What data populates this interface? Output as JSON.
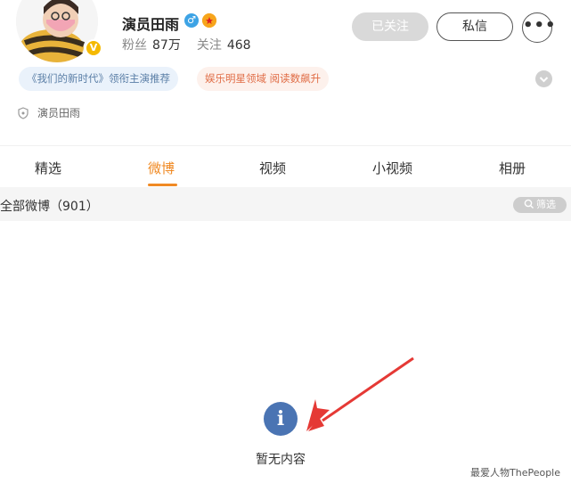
{
  "profile": {
    "username": "演员田雨",
    "fans_label": "粉丝",
    "fans_count": "87万",
    "following_label": "关注",
    "following_count": "468",
    "gender": "♂",
    "verify_mark": "V",
    "tags": {
      "work": "《我们的新时代》领衔主演推荐",
      "field": "娱乐明星领域 阅读数飙升"
    },
    "certification": "演员田雨"
  },
  "actions": {
    "followed": "已关注",
    "message": "私信",
    "more": "•••"
  },
  "tabs": [
    {
      "label": "精选"
    },
    {
      "label": "微博"
    },
    {
      "label": "视频"
    },
    {
      "label": "小视频"
    },
    {
      "label": "相册"
    }
  ],
  "feed": {
    "title": "全部微博（901）",
    "filter": "筛选",
    "empty_text": "暂无内容",
    "info_glyph": "i"
  },
  "watermark": "最爱人物ThePeople",
  "colors": {
    "accent": "#f08a24",
    "info_icon": "#4a74b3",
    "arrow": "#e53935"
  },
  "icons": [
    "verified-badge-icon",
    "male-icon",
    "vip-icon",
    "more-icon",
    "expand-icon",
    "shield-icon",
    "search-icon",
    "info-icon",
    "arrow-icon"
  ]
}
